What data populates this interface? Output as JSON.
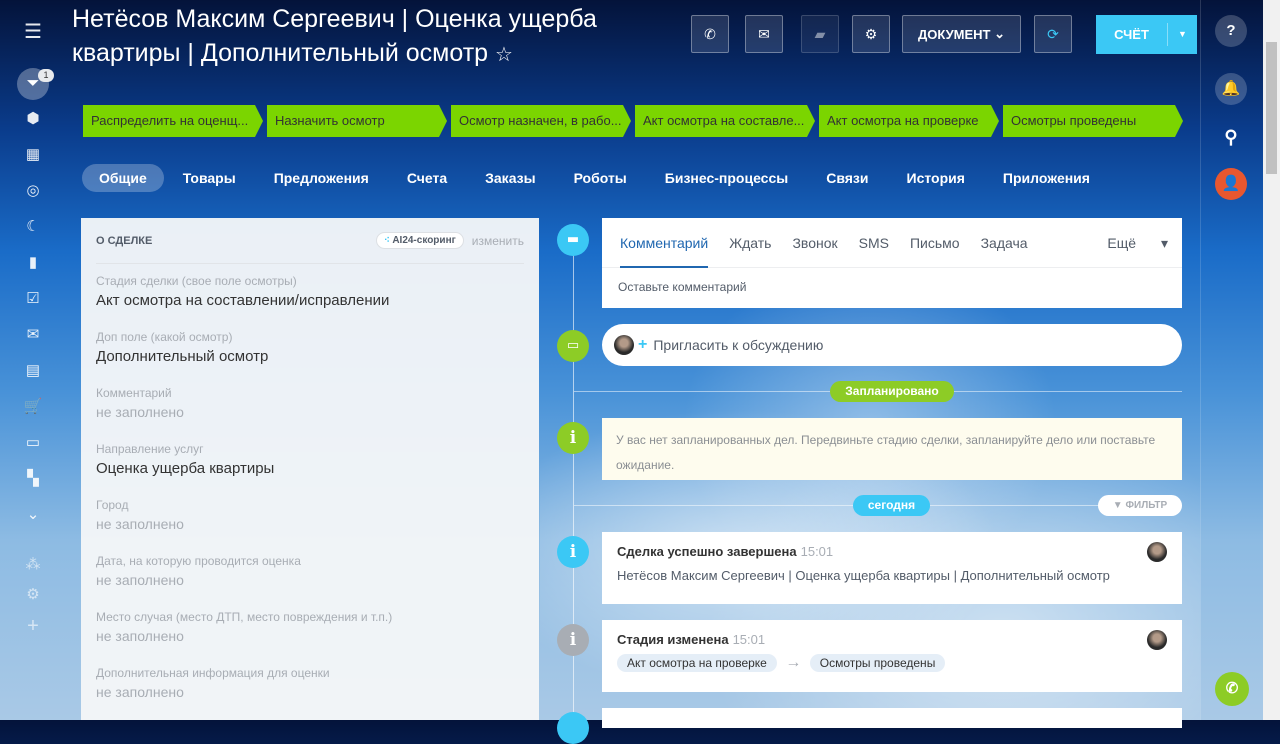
{
  "title": "Нетёсов Максим Сергеевич | Оценка ущерба квартиры | Дополнительный осмотр",
  "sidebar": {
    "counter_badge": "1",
    "icons": [
      "menu-icon",
      "filter-icon",
      "box-icon",
      "calendar-icon",
      "target-icon",
      "moon-icon",
      "chart-icon",
      "task-icon",
      "mail-icon",
      "inbox-icon",
      "cart-icon",
      "window-icon",
      "apps-icon",
      "chevron-down-icon",
      "sitemap-icon",
      "gear-icon",
      "plus-icon"
    ]
  },
  "toolbar": {
    "document_label": "ДОКУМЕНТ",
    "invoice_label": "СЧЁТ"
  },
  "stages": [
    "Распределить на оценщ...",
    "Назначить осмотр",
    "Осмотр назначен, в рабо...",
    "Акт осмотра на составле...",
    "Акт осмотра на проверке",
    "Осмотры проведены"
  ],
  "stage_color": "#7bd500",
  "tabs": [
    "Общие",
    "Товары",
    "Предложения",
    "Счета",
    "Заказы",
    "Роботы",
    "Бизнес-процессы",
    "Связи",
    "История",
    "Приложения"
  ],
  "about": {
    "header": "О СДЕЛКЕ",
    "ai_label": "AI24-скоринг",
    "change_label": "изменить",
    "fields": [
      {
        "label": "Стадия сделки (свое поле осмотры)",
        "value": "Акт осмотра на составлении/исправлении",
        "empty": false
      },
      {
        "label": "Доп поле (какой осмотр)",
        "value": "Дополнительный осмотр",
        "empty": false
      },
      {
        "label": "Комментарий",
        "value": "не заполнено",
        "empty": true
      },
      {
        "label": "Направление услуг",
        "value": "Оценка ущерба квартиры",
        "empty": false
      },
      {
        "label": "Город",
        "value": "не заполнено",
        "empty": true
      },
      {
        "label": "Дата, на которую проводится оценка",
        "value": "не заполнено",
        "empty": true
      },
      {
        "label": "Место случая (место ДТП, место повреждения и т.п.)",
        "value": "не заполнено",
        "empty": true
      },
      {
        "label": "Дополнительная информация для оценки",
        "value": "не заполнено",
        "empty": true
      }
    ]
  },
  "timeline": {
    "tabs": [
      "Комментарий",
      "Ждать",
      "Звонок",
      "SMS",
      "Письмо",
      "Задача"
    ],
    "more": "Ещё",
    "comment_placeholder": "Оставьте комментарий",
    "invite": "Пригласить к обсуждению",
    "planned_badge": "Запланировано",
    "planned_text": "У вас нет запланированных дел. Передвиньте стадию сделки, запланируйте дело или поставьте ожидание.",
    "today_badge": "сегодня",
    "filter": "ФИЛЬТР",
    "events": [
      {
        "title": "Сделка успешно завершена",
        "time": "15:01",
        "text": "Нетёсов Максим Сергеевич | Оценка ущерба квартиры | Дополнительный осмотр"
      },
      {
        "title": "Стадия изменена",
        "time": "15:01",
        "from": "Акт осмотра на проверке",
        "to": "Осмотры проведены"
      }
    ]
  }
}
